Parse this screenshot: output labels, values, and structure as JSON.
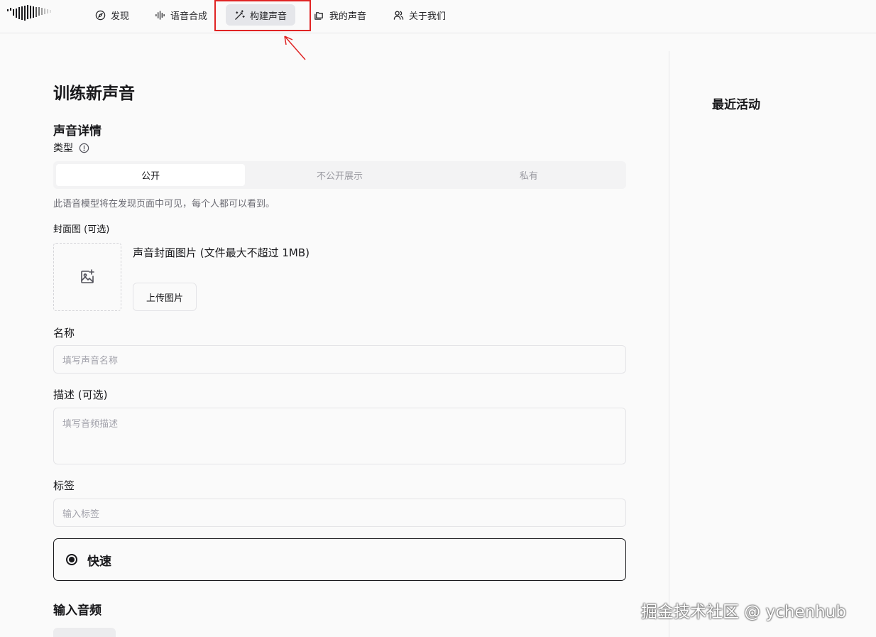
{
  "nav": {
    "items": [
      {
        "label": "发现",
        "icon": "compass-icon"
      },
      {
        "label": "语音合成",
        "icon": "audio-waveform-icon"
      },
      {
        "label": "构建声音",
        "icon": "magic-wand-icon",
        "active": true
      },
      {
        "label": "我的声音",
        "icon": "folders-icon"
      },
      {
        "label": "关于我们",
        "icon": "users-icon"
      }
    ]
  },
  "page": {
    "title": "训练新声音",
    "section_title": "声音详情",
    "type_label": "类型",
    "visibility_options": [
      "公开",
      "不公开展示",
      "私有"
    ],
    "visibility_selected": "公开",
    "visibility_hint": "此语音模型将在发现页面中可见，每个人都可以看到。",
    "cover": {
      "label": "封面图 (可选)",
      "description": "声音封面图片 (文件最大不超过 1MB)",
      "upload_button": "上传图片"
    },
    "name": {
      "label": "名称",
      "placeholder": "填写声音名称"
    },
    "description": {
      "label": "描述 (可选)",
      "placeholder": "填写音频描述"
    },
    "tags": {
      "label": "标签",
      "placeholder": "输入标签"
    },
    "mode": {
      "label": "快速",
      "selected": true
    },
    "audio_section_title": "输入音频"
  },
  "sidebar": {
    "title": "最近活动"
  },
  "watermark": "掘金技术社区 @ ychenhub",
  "colors": {
    "annotation": "#e02424",
    "active_nav_bg": "#e5e6ea",
    "page_bg": "#fafafa"
  }
}
